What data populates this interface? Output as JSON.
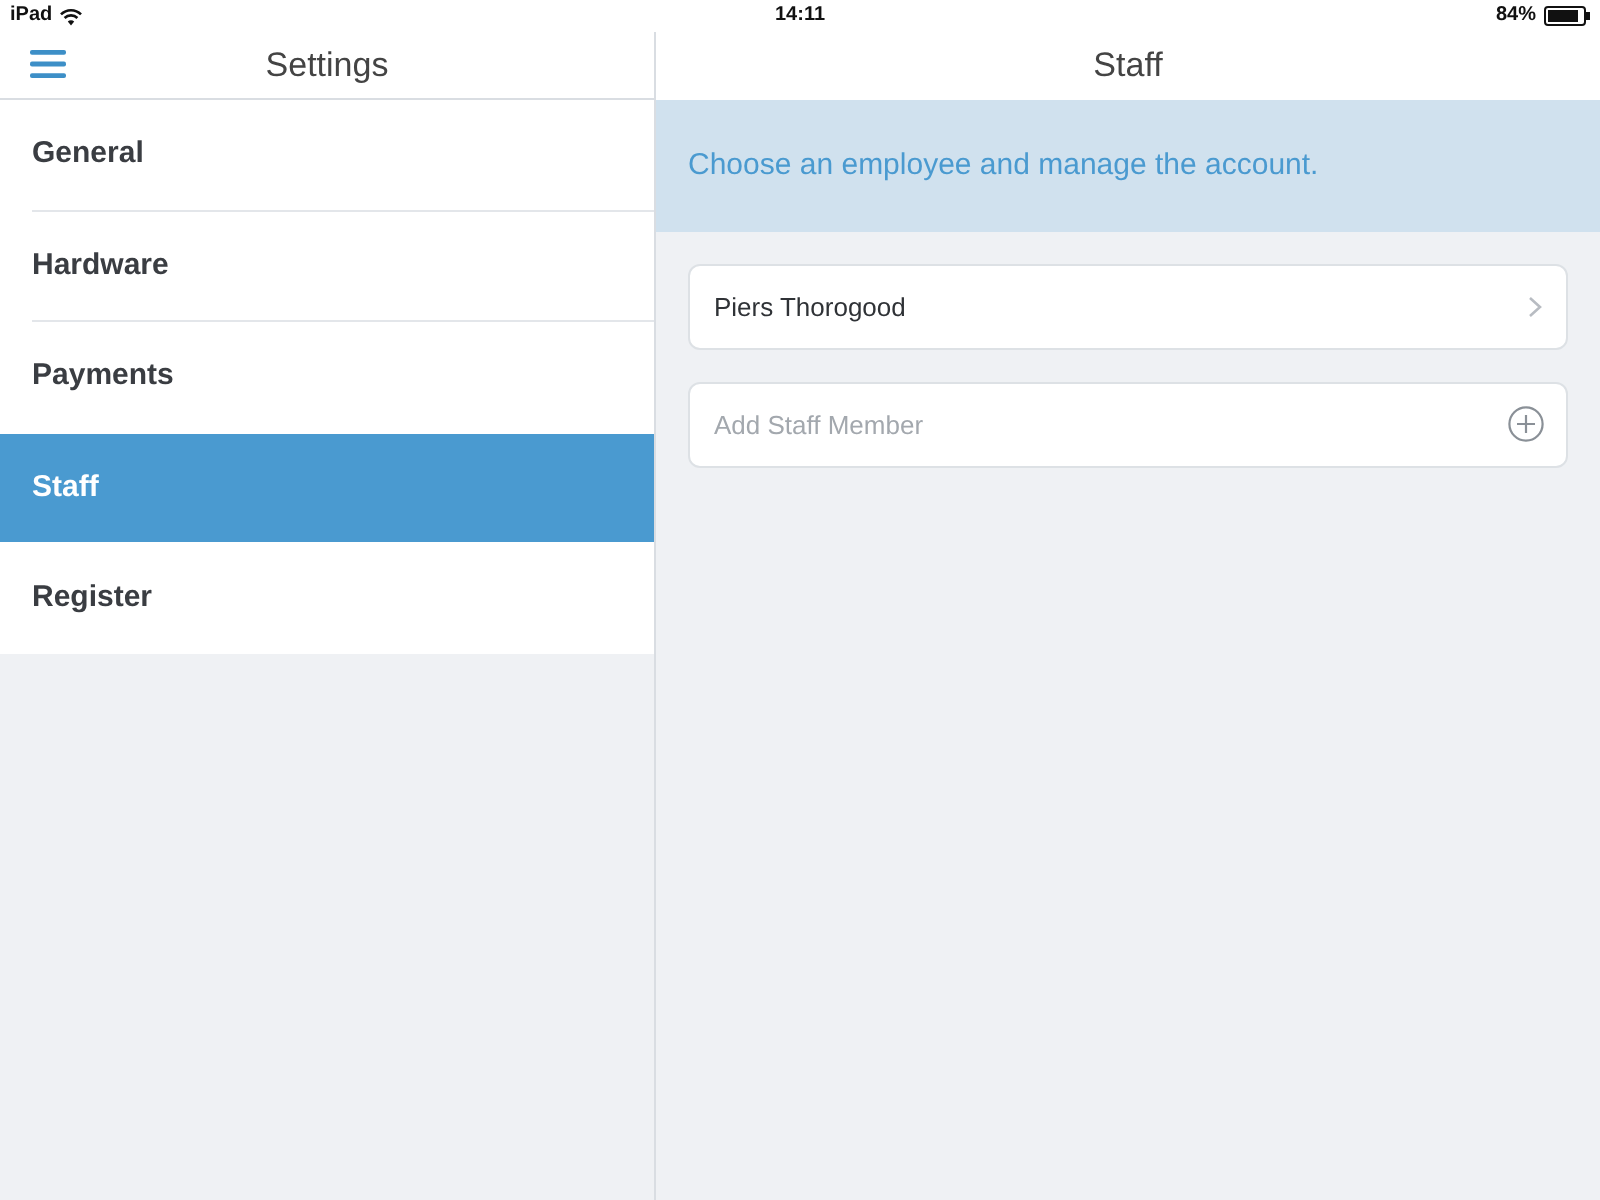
{
  "status_bar": {
    "device": "iPad",
    "time": "14:11",
    "battery": "84%"
  },
  "sidebar": {
    "title": "Settings",
    "items": [
      {
        "label": "General",
        "selected": false
      },
      {
        "label": "Hardware",
        "selected": false
      },
      {
        "label": "Payments",
        "selected": false
      },
      {
        "label": "Staff",
        "selected": true
      },
      {
        "label": "Register",
        "selected": false
      }
    ]
  },
  "detail": {
    "title": "Staff",
    "banner": "Choose an employee and manage the account.",
    "employees": [
      {
        "name": "Piers Thorogood"
      }
    ],
    "add_field": {
      "placeholder": "Add Staff Member"
    }
  }
}
